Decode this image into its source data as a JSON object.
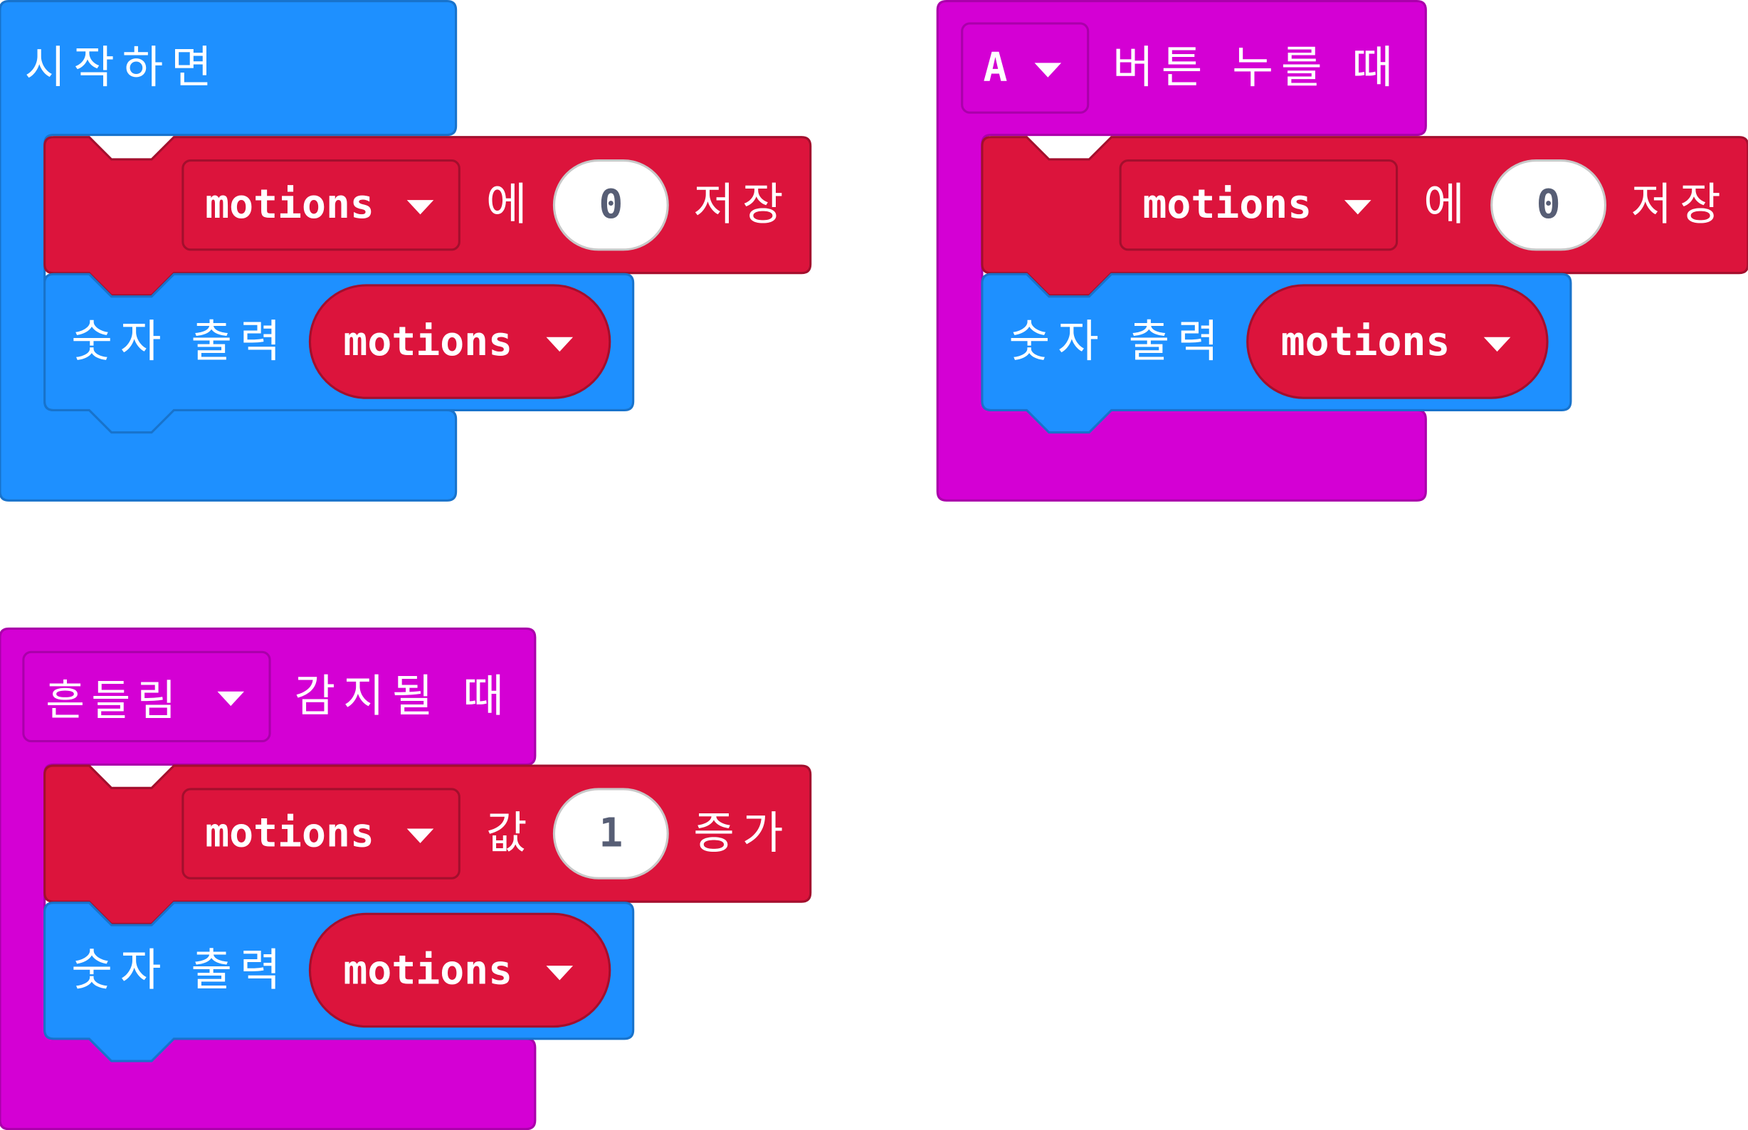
{
  "colors": {
    "basic": "#1e90ff",
    "basic_border": "#1873cc",
    "variables": "#dc143c",
    "variables_border": "#a30f2d",
    "input": "#d400d4",
    "input_border": "#aa00aa",
    "number_text": "#575e75"
  },
  "block_on_start": {
    "label": "시작하면",
    "set_block": {
      "variable": "motions",
      "connector": "에",
      "value": "0",
      "action": "저장"
    },
    "show_block": {
      "label": "숫자 출력",
      "variable": "motions"
    }
  },
  "block_on_button": {
    "button": "A",
    "label": "버튼 누를 때",
    "set_block": {
      "variable": "motions",
      "connector": "에",
      "value": "0",
      "action": "저장"
    },
    "show_block": {
      "label": "숫자 출력",
      "variable": "motions"
    }
  },
  "block_on_gesture": {
    "gesture": "흔들림",
    "label": "감지될 때",
    "change_block": {
      "variable": "motions",
      "connector": "값",
      "value": "1",
      "action": "증가"
    },
    "show_block": {
      "label": "숫자 출력",
      "variable": "motions"
    }
  },
  "icons": {
    "dropdown": "triangle-down-icon"
  }
}
